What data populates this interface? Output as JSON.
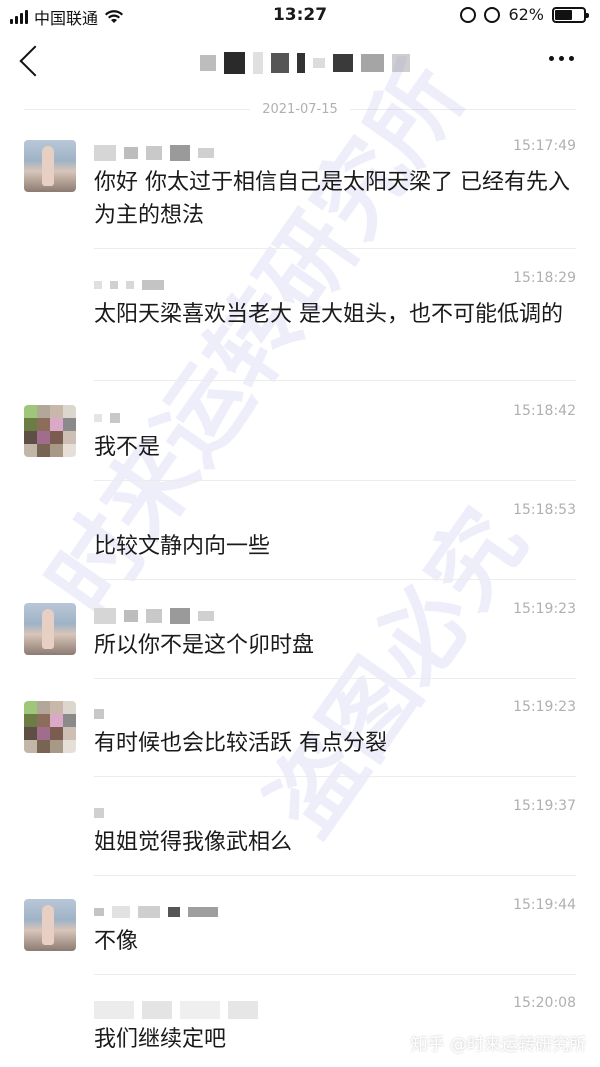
{
  "status_bar": {
    "carrier": "中国联通",
    "time": "13:27",
    "battery": "62%",
    "battery_level": 0.62,
    "icons": [
      "signal-icon",
      "wifi-icon",
      "orientation-lock-icon",
      "alarm-icon",
      "battery-icon"
    ]
  },
  "nav": {
    "icons": [
      "back-icon",
      "more-icon"
    ]
  },
  "date_separator": "2021-07-15",
  "messages": [
    {
      "avatar": "avatar-a",
      "time": "15:17:49",
      "text": "你好 你太过于相信自己是太阳天梁了 已经有先入为主的想法"
    },
    {
      "avatar": "",
      "time": "15:18:29",
      "text": "太阳天梁喜欢当老大 是大姐头，也不可能低调的"
    },
    {
      "avatar": "avatar-b",
      "time": "15:18:42",
      "text": "我不是"
    },
    {
      "avatar": "",
      "time": "15:18:53",
      "text": "比较文静内向一些"
    },
    {
      "avatar": "avatar-a",
      "time": "15:19:23",
      "text": "所以你不是这个卯时盘"
    },
    {
      "avatar": "avatar-b",
      "time": "15:19:23",
      "text": "有时候也会比较活跃 有点分裂"
    },
    {
      "avatar": "",
      "time": "15:19:37",
      "text": "姐姐觉得我像武相么"
    },
    {
      "avatar": "avatar-a",
      "time": "15:19:44",
      "text": "不像"
    },
    {
      "avatar": "",
      "time": "15:20:08",
      "text": "我们继续定吧"
    }
  ],
  "watermark": {
    "line1": "时来运转研究所",
    "line2": "盗图必究"
  },
  "footer_watermark": "知乎 @时来运转研究所"
}
